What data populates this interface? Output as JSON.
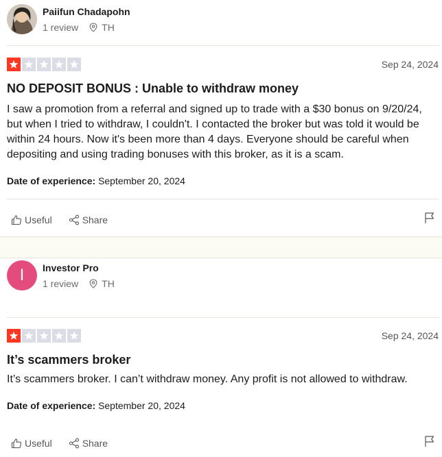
{
  "reviews": [
    {
      "consumer": {
        "name": "Paiifun Chadapohn",
        "review_count": "1 review",
        "country": "TH",
        "avatar_type": "photo"
      },
      "rating": 1,
      "date": "Sep 24, 2024",
      "title": "NO DEPOSIT BONUS : Unable to withdraw money",
      "body": "I saw a promotion from a referral and signed up to trade with a $30 bonus on 9/20/24, but when I tried to withdraw, I couldn't. I contacted the broker but was told it would be within 24 hours. Now it's been more than 4 days. Everyone should be careful when depositing and using trading bonuses with this broker, as it is a scam.",
      "experience_label": "Date of experience:",
      "experience_date": "September 20, 2024",
      "actions": {
        "useful": "Useful",
        "share": "Share"
      }
    },
    {
      "consumer": {
        "name": "Investor Pro",
        "review_count": "1 review",
        "country": "TH",
        "avatar_type": "initial",
        "avatar_initial": "I",
        "avatar_color": "#e44c7d"
      },
      "rating": 1,
      "date": "Sep 24, 2024",
      "title": "It’s scammers broker",
      "body": "It’s scammers broker. I can’t withdraw money. Any profit is not allowed to withdraw.",
      "experience_label": "Date of experience:",
      "experience_date": "September 20, 2024",
      "actions": {
        "useful": "Useful",
        "share": "Share"
      }
    }
  ],
  "colors": {
    "star_filled": "#ff3722",
    "star_empty": "#dcdce6",
    "separator_bg": "#fcfbf3"
  },
  "icons": [
    "location-pin-icon",
    "star-icon",
    "thumbs-up-icon",
    "share-icon",
    "flag-icon"
  ]
}
